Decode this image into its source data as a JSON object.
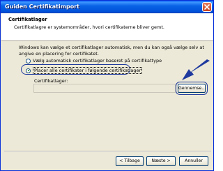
{
  "window": {
    "title": "Guiden Certifikatimport"
  },
  "header": {
    "title": "Certifikatlager",
    "subtitle": "Certifikatlagre er systemområder, hvori certifikaterne bliver gemt."
  },
  "description": {
    "line1": "Windows kan vælge et certifikatlager automatisk, men du kan også vælge selv at",
    "line2": "angive en placering for certifikatet."
  },
  "options": {
    "auto": {
      "label": "Vælg automatisk certifikatlager baseret på certifikattype",
      "selected": false
    },
    "manual": {
      "label": "Placer alle certifikater i følgende certifikatlager",
      "selected": true
    }
  },
  "store": {
    "label": "Certifikatlager:",
    "value": "",
    "browse_label": "Gennemse..."
  },
  "buttons": {
    "back": "< Tilbage",
    "next": "Næste >",
    "cancel": "Annuller"
  },
  "colors": {
    "titlebar": "#0a5ef3",
    "dialog_bg": "#ece9d8",
    "callout": "#1f3a9e"
  }
}
